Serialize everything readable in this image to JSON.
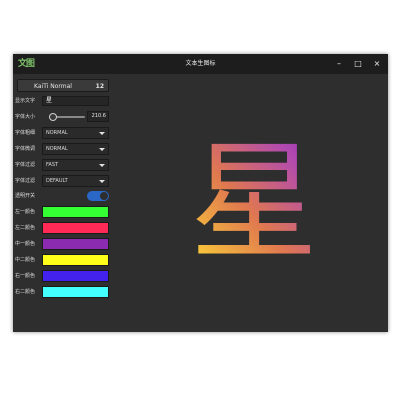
{
  "window": {
    "app_icon": "文图",
    "title": "文本生图标",
    "minimize": "–",
    "maximize": "□",
    "close": "×"
  },
  "font_button": {
    "name": "KaiTi Normal",
    "size": "12"
  },
  "settings": {
    "text": {
      "label": "显示文字",
      "value": "星"
    },
    "font_size": {
      "label": "字体大小",
      "value": "210.6",
      "slider_level": 0.1
    },
    "combos": [
      {
        "label": "字体粗细",
        "value": "NORMAL"
      },
      {
        "label": "字体微调",
        "value": "NORMAL"
      },
      {
        "label": "字体过滤",
        "value": "FAST"
      },
      {
        "label": "字体过滤",
        "value": "DEFAULT"
      }
    ],
    "transparent": {
      "label": "透明开关",
      "on": true
    },
    "colors": [
      {
        "label": "左一颜色",
        "hex": "#33ff33"
      },
      {
        "label": "左二颜色",
        "hex": "#ff2a55"
      },
      {
        "label": "中一颜色",
        "hex": "#8a2bb2"
      },
      {
        "label": "中二颜色",
        "hex": "#ffff1a"
      },
      {
        "label": "右一颜色",
        "hex": "#4422ee"
      },
      {
        "label": "右二颜色",
        "hex": "#44ffff"
      }
    ]
  },
  "preview": {
    "character": "星",
    "gradient": [
      "#ffe033",
      "#e07850",
      "#b24ab0",
      "#8a2bb2"
    ]
  }
}
